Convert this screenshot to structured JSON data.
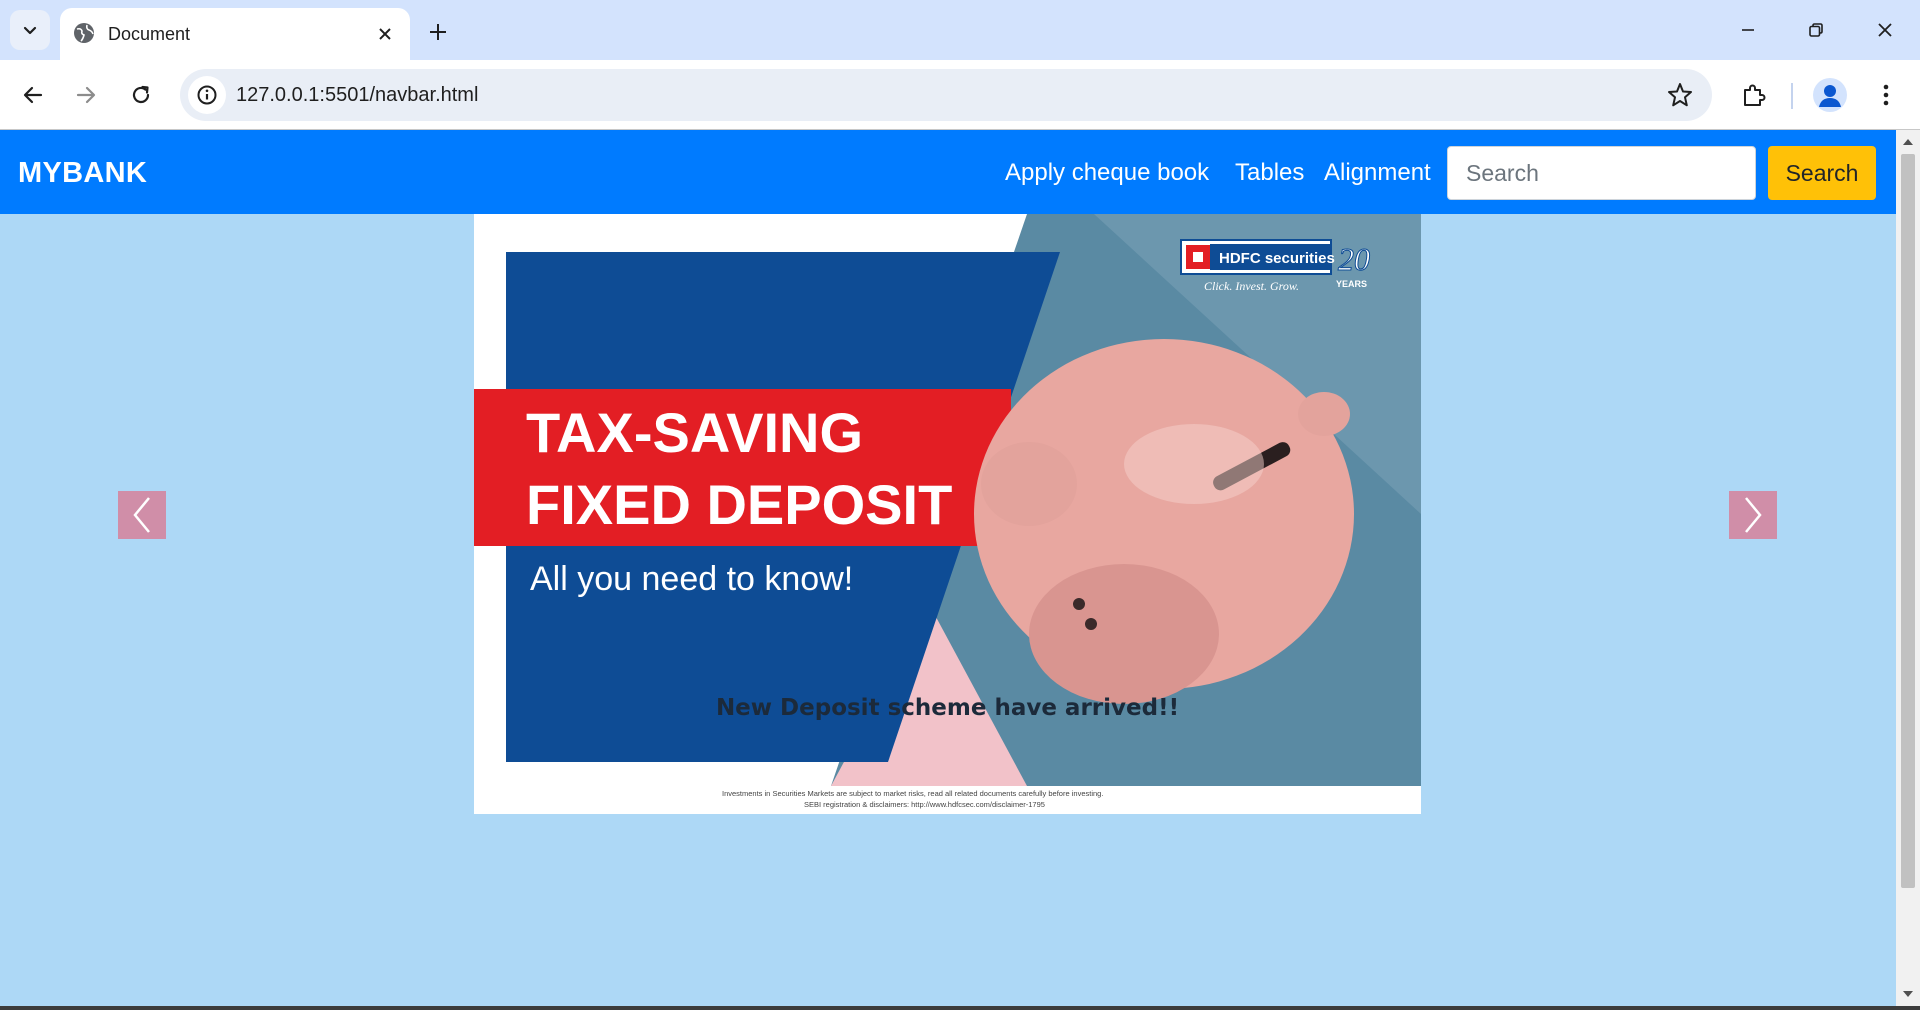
{
  "browser": {
    "tab": {
      "title": "Document",
      "favicon": "globe-icon"
    },
    "url": "127.0.0.1:5501/navbar.html",
    "icons": {
      "tab_search": "chevron-down-icon",
      "tab_close": "close-icon",
      "new_tab": "plus-icon",
      "minimize": "minimize-icon",
      "restore": "restore-icon",
      "close_window": "close-icon",
      "back": "back-arrow-icon",
      "forward": "forward-arrow-icon",
      "reload": "reload-icon",
      "site_info": "info-icon",
      "bookmark": "star-icon",
      "extensions": "puzzle-icon",
      "profile": "person-icon",
      "menu": "kebab-menu-icon"
    }
  },
  "navbar": {
    "brand": "MYBANK",
    "links": [
      "Apply cheque book",
      "Tables",
      "Alignment"
    ],
    "search": {
      "placeholder": "Search",
      "value": "",
      "button_label": "Search"
    },
    "colors": {
      "background": "#007bff",
      "search_button": "#ffc107"
    }
  },
  "carousel": {
    "slide": {
      "image_text": {
        "logo": "HDFC securities",
        "logo_tagline": "Click. Invest. Grow.",
        "years_badge": "20",
        "years_label": "YEARS",
        "headline_line1": "TAX-SAVING",
        "headline_line2": "FIXED DEPOSIT",
        "subheadline": "All you need to know!",
        "disclaimer_line1": "Investments in Securities Markets are subject to market risks, read all related documents carefully before investing.",
        "disclaimer_line2": "SEBI registration & disclaimers: http://www.hdfcsec.com/disclaimer-1795"
      },
      "caption": "New Deposit scheme have arrived!!"
    },
    "controls": {
      "prev": "chevron-left-icon",
      "next": "chevron-right-icon"
    },
    "colors": {
      "page_background": "#add8f6",
      "arrow_background": "#d08ea8"
    }
  }
}
